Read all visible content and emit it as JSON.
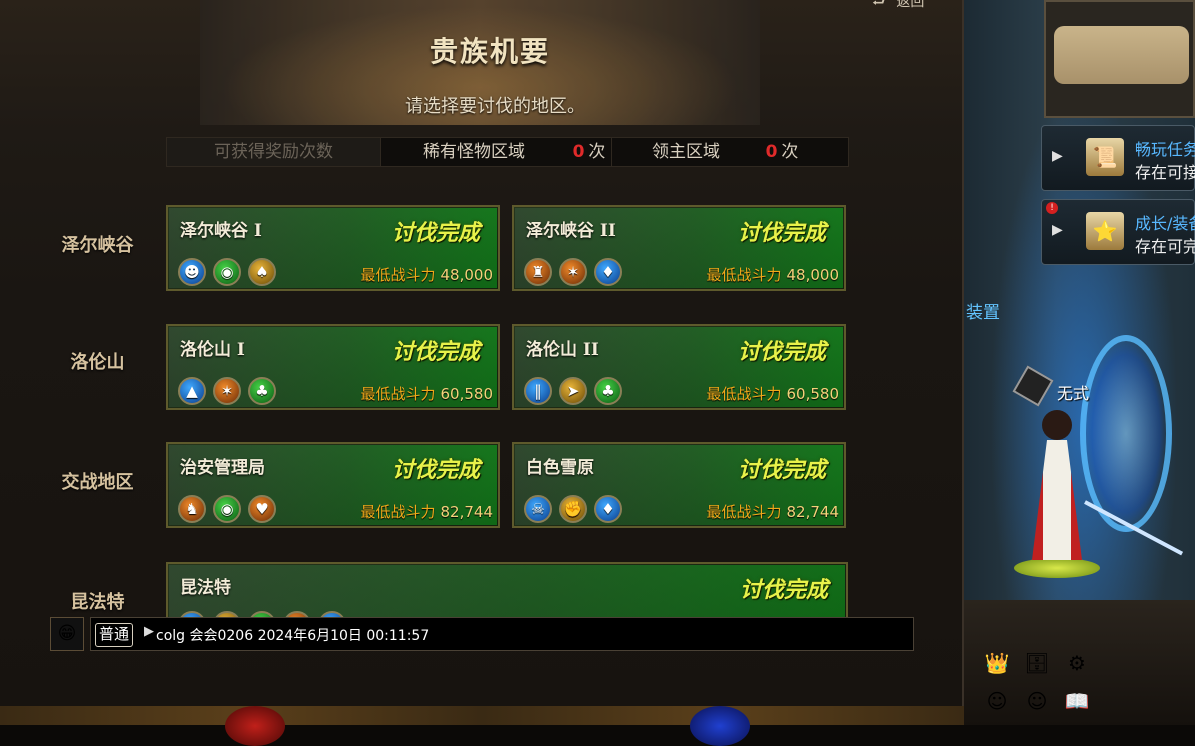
{
  "header": {
    "title": "贵族机要",
    "subtitle": "请选择要讨伐的地区。",
    "return_label": "返回"
  },
  "reward_bar": {
    "reward_label": "可获得奖励次数",
    "rare_label": "稀有怪物区域",
    "rare_count": "0",
    "lord_label": "领主区域",
    "lord_count": "0",
    "times_unit": "次"
  },
  "regions": [
    {
      "label": "泽尔峡谷",
      "dungeons": [
        {
          "name": "泽尔峡谷 I",
          "status": "讨伐完成",
          "power_label": "最低战斗力",
          "power": "48,000",
          "icons": [
            "blue-face-emblem",
            "green-eye-emblem",
            "gold-spade-emblem"
          ]
        },
        {
          "name": "泽尔峡谷 II",
          "status": "讨伐完成",
          "power_label": "最低战斗力",
          "power": "48,000",
          "icons": [
            "orange-tower-emblem",
            "orange-claw-emblem",
            "blue-diamond-emblem"
          ]
        }
      ]
    },
    {
      "label": "洛伦山",
      "dungeons": [
        {
          "name": "洛伦山 I",
          "status": "讨伐完成",
          "power_label": "最低战斗力",
          "power": "60,580",
          "icons": [
            "blue-tower-emblem",
            "orange-claw-emblem",
            "green-club-emblem"
          ]
        },
        {
          "name": "洛伦山 II",
          "status": "讨伐完成",
          "power_label": "最低战斗力",
          "power": "60,580",
          "icons": [
            "blue-pillar-emblem",
            "gold-wing-emblem",
            "green-club-emblem"
          ]
        }
      ]
    },
    {
      "label": "交战地区",
      "dungeons": [
        {
          "name": "治安管理局",
          "status": "讨伐完成",
          "power_label": "最低战斗力",
          "power": "82,744",
          "icons": [
            "orange-warrior-emblem",
            "green-eye-emblem",
            "orange-heart-emblem"
          ]
        },
        {
          "name": "白色雪原",
          "status": "讨伐完成",
          "power_label": "最低战斗力",
          "power": "82,744",
          "icons": [
            "blue-mask-emblem",
            "gold-fist-emblem",
            "blue-diamond-emblem"
          ]
        }
      ]
    },
    {
      "label": "昆法特",
      "dungeons": [
        {
          "name": "昆法特",
          "status": "讨伐完成"
        }
      ]
    }
  ],
  "chat": {
    "channel": "普通",
    "text": "colg 会会0206 2024年6月10日 00:11:57"
  },
  "side": {
    "quests": [
      {
        "title": "畅玩任务",
        "desc": "存在可接"
      },
      {
        "title": "成长/装备",
        "desc": "存在可完"
      }
    ],
    "settings_label": "装置",
    "player_name": "无式",
    "colors": {
      "accent_green": "#1f9a22",
      "status_yellow": "#e8f24a",
      "power_orange": "#f1a91a",
      "count_red": "#e02a2a",
      "link_blue": "#58b8ff"
    }
  }
}
